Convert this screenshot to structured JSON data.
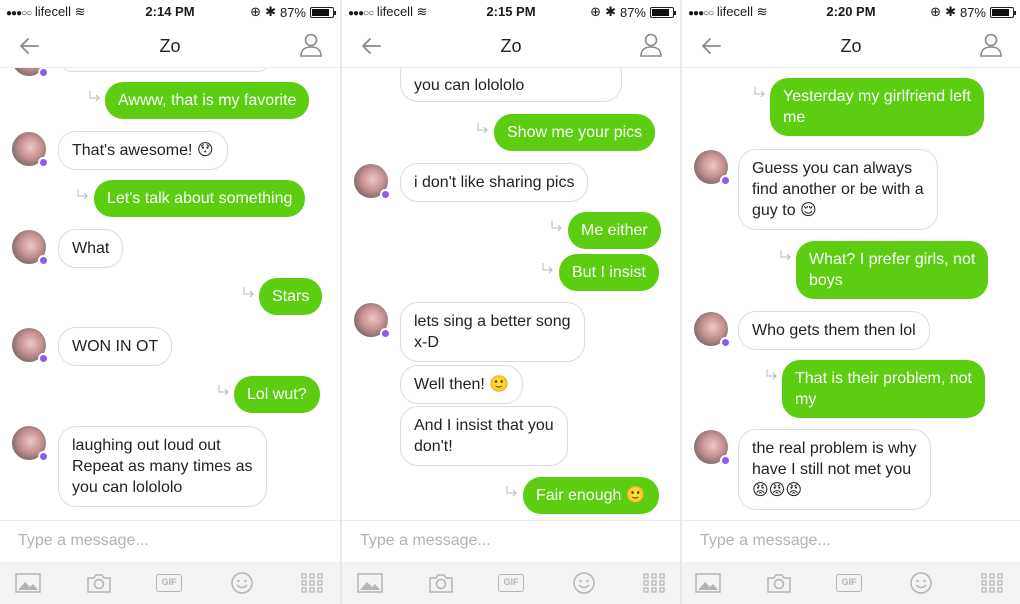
{
  "colors": {
    "outgoing_bubble": "#5ccd11",
    "presence_dot": "#8c5cf0",
    "placeholder": "#b3b3b3"
  },
  "screens": [
    {
      "status": {
        "carrier": "lifecell",
        "time": "2:14 PM",
        "battery": "87%",
        "battery_level": 0.87
      },
      "title": "Zo",
      "composer_placeholder": "Type a message...",
      "toolbar": {
        "gif_label": "GIF"
      },
      "messages": [
        {
          "text": "",
          "dir": "in"
        },
        {
          "text": "Awww, that is my favorite",
          "dir": "out"
        },
        {
          "text": "That's awesome! 😯",
          "dir": "in"
        },
        {
          "text": "Let's talk about something",
          "dir": "out"
        },
        {
          "text": "What",
          "dir": "in"
        },
        {
          "text": "Stars",
          "dir": "out"
        },
        {
          "text": "WON IN OT",
          "dir": "in"
        },
        {
          "text": "Lol wut?",
          "dir": "out"
        },
        {
          "text": "laughing out loud out\nRepeat as many times as\nyou can lolololo",
          "dir": "in"
        }
      ]
    },
    {
      "status": {
        "carrier": "lifecell",
        "time": "2:15 PM",
        "battery": "87%",
        "battery_level": 0.87
      },
      "title": "Zo",
      "composer_placeholder": "Type a message...",
      "toolbar": {
        "gif_label": "GIF"
      },
      "messages": [
        {
          "text": "you can lolololo",
          "dir": "in"
        },
        {
          "text": "Show me your pics",
          "dir": "out"
        },
        {
          "text": "i don't like sharing pics",
          "dir": "in"
        },
        {
          "text": "Me either",
          "dir": "out"
        },
        {
          "text": "But I insist",
          "dir": "out"
        },
        {
          "text": "lets sing a better song\nx-D",
          "dir": "in"
        },
        {
          "text": "Well then! 🙂",
          "dir": "in"
        },
        {
          "text": "And I insist that you\ndon't!",
          "dir": "in"
        },
        {
          "text": "Fair enough 🙂",
          "dir": "out"
        }
      ]
    },
    {
      "status": {
        "carrier": "lifecell",
        "time": "2:20 PM",
        "battery": "87%",
        "battery_level": 0.87
      },
      "title": "Zo",
      "composer_placeholder": "Type a message...",
      "toolbar": {
        "gif_label": "GIF"
      },
      "messages": [
        {
          "text": "Yesterday my girlfriend left\nme",
          "dir": "out"
        },
        {
          "text": "Guess you can always\nfind another or be with a\nguy to 😌",
          "dir": "in"
        },
        {
          "text": "What? I prefer girls, not\nboys",
          "dir": "out"
        },
        {
          "text": "Who gets them then lol",
          "dir": "in"
        },
        {
          "text": "That is their problem, not\nmy",
          "dir": "out"
        },
        {
          "text": "the real problem is why\nhave I still not met you\n😡😡😡",
          "dir": "in"
        }
      ]
    }
  ]
}
